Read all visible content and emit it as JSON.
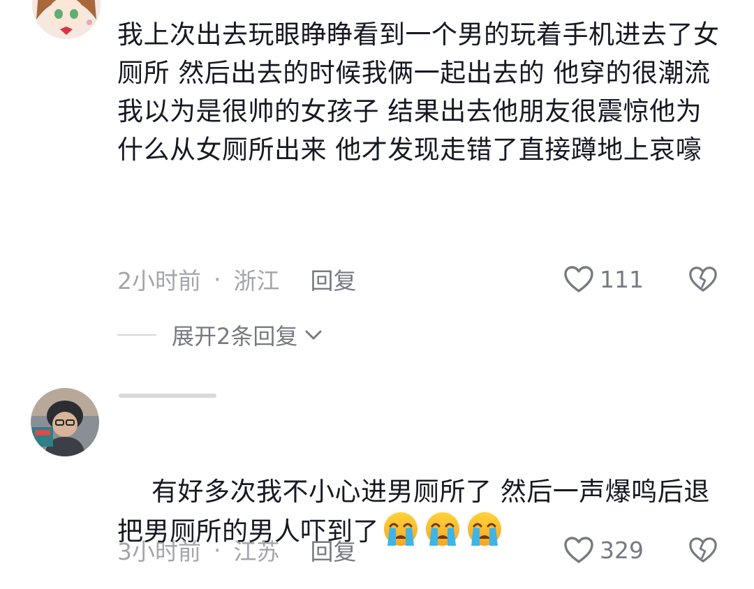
{
  "comments": [
    {
      "text": "我上次出去玩眼睁睁看到一个男的玩着手机进去了女厕所 然后出去的时候我俩一起出去的 他穿的很潮流我以为是很帅的女孩子 结果出去他朋友很震惊他为什么从女厕所出来 他才发现走错了直接蹲地上哀嚎",
      "time": "2小时前",
      "separator": "·",
      "location": "浙江",
      "reply_label": "回复",
      "likes": "111"
    },
    {
      "text": "有好多次我不小心进男厕所了 然后一声爆鸣后退 把男厕所的男人吓到了",
      "emojis": [
        "crying-face",
        "crying-face",
        "crying-face"
      ],
      "time": "3小时前",
      "separator": "·",
      "location": "江苏",
      "reply_label": "回复",
      "likes": "329"
    }
  ],
  "expand_replies": "展开2条回复",
  "colors": {
    "text": "#161823",
    "meta": "#a4a5ab",
    "secondary": "#777982",
    "divider": "#d6d6d9"
  }
}
